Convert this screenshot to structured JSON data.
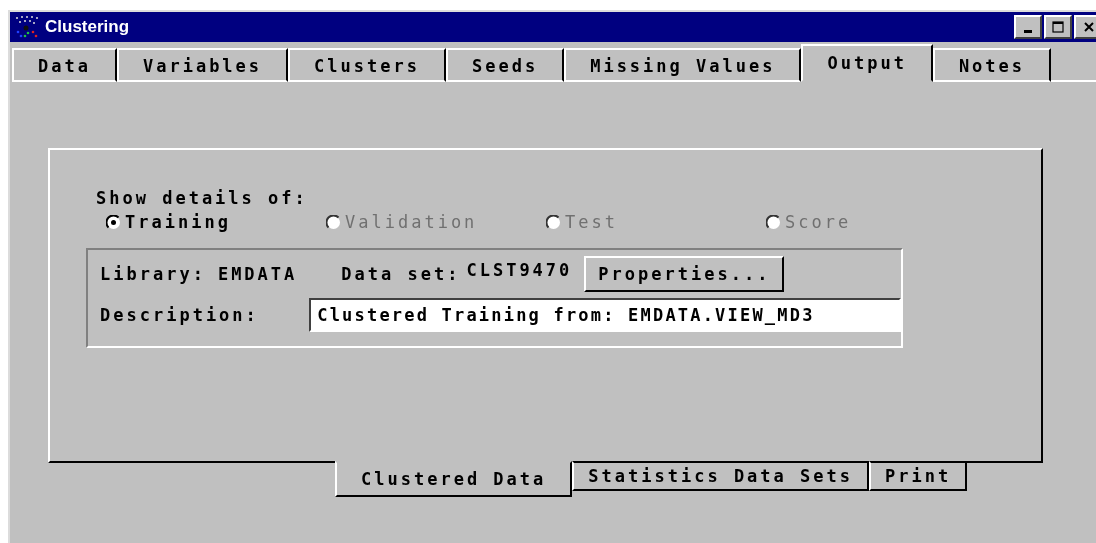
{
  "window": {
    "title": "Clustering"
  },
  "tabs": [
    {
      "label": "Data",
      "selected": false
    },
    {
      "label": "Variables",
      "selected": false
    },
    {
      "label": "Clusters",
      "selected": false
    },
    {
      "label": "Seeds",
      "selected": false
    },
    {
      "label": "Missing Values",
      "selected": false
    },
    {
      "label": "Output",
      "selected": true
    },
    {
      "label": "Notes",
      "selected": false
    }
  ],
  "details_label": "Show details of:",
  "radios": [
    {
      "label": "Training",
      "selected": true,
      "disabled": false
    },
    {
      "label": "Validation",
      "selected": false,
      "disabled": true
    },
    {
      "label": "Test",
      "selected": false,
      "disabled": true
    },
    {
      "label": "Score",
      "selected": false,
      "disabled": true
    }
  ],
  "data_set_group": {
    "library_label": "Library:",
    "library": "EMDATA",
    "dataset_label": "Data set:",
    "dataset": "CLST9470",
    "properties_button": "Properties...",
    "description_label": "Description:",
    "description": "Clustered Training from: EMDATA.VIEW_MD3"
  },
  "bottom_tabs": [
    {
      "label": "Clustered Data",
      "selected": true
    },
    {
      "label": "Statistics Data Sets",
      "selected": false
    },
    {
      "label": "Print",
      "selected": false
    }
  ]
}
